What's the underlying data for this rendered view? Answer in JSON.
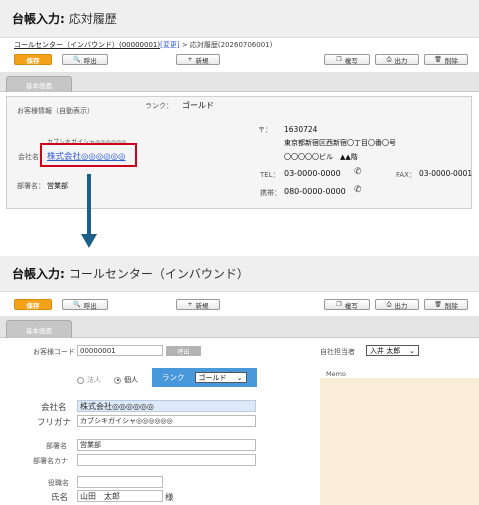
{
  "panel1": {
    "title_bold": "台帳入力:",
    "title_rest": "応対履歴",
    "breadcrumb": {
      "link": "コールセンター（インバウンド）(00000001)",
      "change": "[変更]",
      "sep": ">",
      "current": "応対履歴(20260706001)"
    },
    "toolbar": {
      "save": "保存",
      "call": "呼出",
      "new": "新規",
      "copy": "複写",
      "output": "出力",
      "delete": "削除"
    },
    "tab": "基本画面",
    "info": {
      "section_label": "お客様情報（自動表示）",
      "rank_label": "ランク：",
      "rank_value": "ゴールド",
      "kana": "カブシキガイシャ◎◎◎◎◎◎",
      "company_label": "会社名:",
      "company_value": "株式会社◎◎◎◎◎◎",
      "dept_label": "部署名：",
      "dept_value": "営業部",
      "postal_label": "〒：",
      "postal_value": "1630724",
      "address1": "東京都新宿区西新宿〇丁目〇番〇号",
      "address2": "〇〇〇〇〇ビル　▲▲階",
      "tel_label": "TEL：",
      "tel_value": "03-0000-0000",
      "mobile_label": "携帯：",
      "mobile_value": "080-0000-0000",
      "fax_label": "FAX：",
      "fax_value": "03-0000-0001"
    }
  },
  "panel2": {
    "title_bold": "台帳入力:",
    "title_rest": "コールセンター（インバウンド）",
    "toolbar": {
      "save": "保存",
      "call": "呼出",
      "new": "新規",
      "copy": "複写",
      "output": "出力",
      "delete": "削除"
    },
    "tab": "基本画面",
    "form": {
      "customer_code_label": "お客様コード",
      "customer_code_value": "00000001",
      "call_button": "呼出",
      "person_in_charge_label": "自社担当者",
      "person_in_charge_value": "入井 太郎",
      "corp_radio": "法人",
      "individual_radio": "個人",
      "rank_label": "ランク",
      "rank_value": "ゴールド",
      "memo_label": "Memo",
      "company_label": "会社名",
      "company_value": "株式会社◎◎◎◎◎◎",
      "furigana_label": "フリガナ",
      "furigana_value": "カブシキガイシャ◎◎◎◎◎◎",
      "dept_label": "部署名",
      "dept_value": "営業部",
      "dept_kana_label": "部署名カナ",
      "dept_kana_value": "",
      "position_label": "役職名",
      "position_value": "",
      "name_label": "氏名",
      "last_name": "山田",
      "first_name": "太郎",
      "honorific": "様"
    }
  },
  "colors": {
    "save_button": "#f4a21a",
    "rank_bar": "#4a98dc",
    "highlight_box": "#d0021b",
    "arrow": "#1d5f88",
    "memo_bg": "#faedd8",
    "filled_input": "#dde9f6"
  }
}
